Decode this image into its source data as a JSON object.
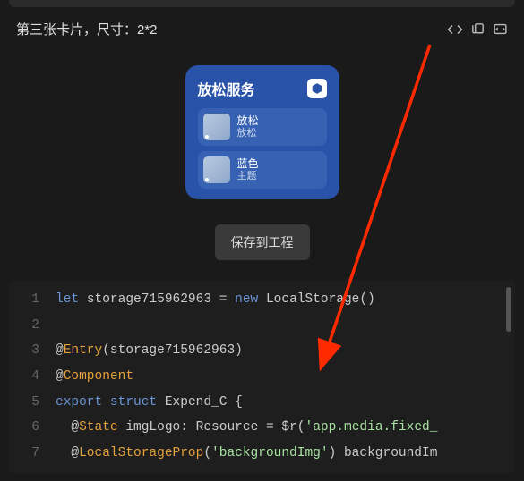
{
  "header": {
    "title": "第三张卡片，尺寸：2*2"
  },
  "card": {
    "title": "放松服务",
    "items": [
      {
        "label": "放松",
        "sub": "放松"
      },
      {
        "label": "蓝色",
        "sub": "主题"
      }
    ]
  },
  "saveButton": "保存到工程",
  "code": {
    "lines": [
      {
        "n": "1",
        "tokens": [
          [
            "kw-let",
            "let"
          ],
          [
            "",
            " "
          ],
          [
            "ident",
            "storage715962963"
          ],
          [
            "",
            " "
          ],
          [
            "op",
            "="
          ],
          [
            "",
            " "
          ],
          [
            "kw-new",
            "new"
          ],
          [
            "",
            " "
          ],
          [
            "type",
            "LocalStorage"
          ],
          [
            "punct",
            "()"
          ]
        ]
      },
      {
        "n": "2",
        "tokens": [
          [
            "",
            ""
          ]
        ]
      },
      {
        "n": "3",
        "tokens": [
          [
            "punct",
            "@"
          ],
          [
            "deco",
            "Entry"
          ],
          [
            "punct",
            "("
          ],
          [
            "ident",
            "storage715962963"
          ],
          [
            "punct",
            ")"
          ]
        ]
      },
      {
        "n": "4",
        "tokens": [
          [
            "punct",
            "@"
          ],
          [
            "deco",
            "Component"
          ]
        ]
      },
      {
        "n": "5",
        "tokens": [
          [
            "kw-export",
            "export"
          ],
          [
            "",
            " "
          ],
          [
            "kw-struct",
            "struct"
          ],
          [
            "",
            " "
          ],
          [
            "type",
            "Expend_C"
          ],
          [
            "",
            " "
          ],
          [
            "punct",
            "{"
          ]
        ]
      },
      {
        "n": "6",
        "tokens": [
          [
            "",
            "  "
          ],
          [
            "punct",
            "@"
          ],
          [
            "deco",
            "State"
          ],
          [
            "",
            " "
          ],
          [
            "ident",
            "imgLogo"
          ],
          [
            "punct",
            ":"
          ],
          [
            "",
            " "
          ],
          [
            "type",
            "Resource"
          ],
          [
            "",
            " "
          ],
          [
            "op",
            "="
          ],
          [
            "",
            " "
          ],
          [
            "func",
            "$r"
          ],
          [
            "punct",
            "("
          ],
          [
            "str",
            "'app.media.fixed_"
          ]
        ]
      },
      {
        "n": "7",
        "tokens": [
          [
            "",
            "  "
          ],
          [
            "punct",
            "@"
          ],
          [
            "deco",
            "LocalStorageProp"
          ],
          [
            "punct",
            "("
          ],
          [
            "str",
            "'backgroundImg'"
          ],
          [
            "punct",
            ")"
          ],
          [
            "",
            " "
          ],
          [
            "ident",
            "backgroundIm"
          ]
        ]
      }
    ]
  }
}
